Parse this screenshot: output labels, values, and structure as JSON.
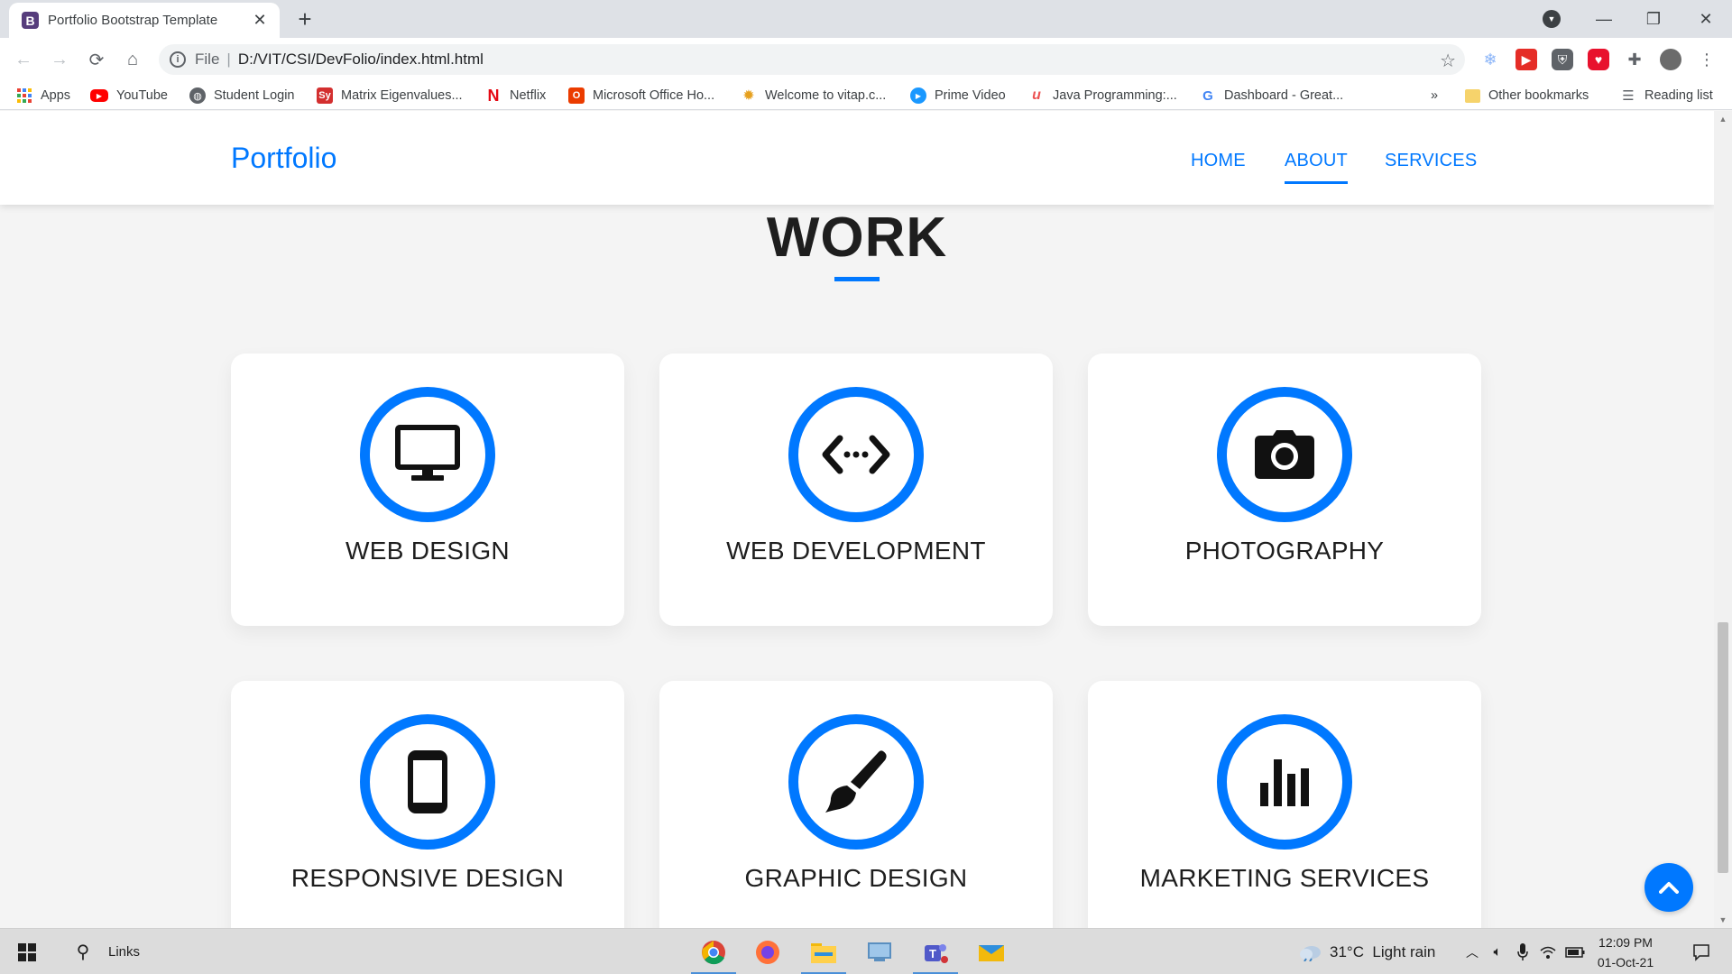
{
  "browser": {
    "tab_title": "Portfolio Bootstrap Template",
    "tab_favicon": "B",
    "address_scheme": "File",
    "address_url": "D:/VIT/CSI/DevFolio/index.html.html"
  },
  "bookmarks": {
    "items": [
      {
        "label": "Apps",
        "icon": "apps-grid-icon"
      },
      {
        "label": "YouTube",
        "icon": "youtube-icon"
      },
      {
        "label": "Student Login",
        "icon": "globe-icon"
      },
      {
        "label": "Matrix Eigenvalues...",
        "icon": "symbolab-icon"
      },
      {
        "label": "Netflix",
        "icon": "netflix-icon"
      },
      {
        "label": "Microsoft Office Ho...",
        "icon": "office-icon"
      },
      {
        "label": "Welcome to vitap.c...",
        "icon": "vitap-icon"
      },
      {
        "label": "Prime Video",
        "icon": "prime-video-icon"
      },
      {
        "label": "Java Programming:...",
        "icon": "udemy-icon"
      },
      {
        "label": "Dashboard - Great...",
        "icon": "google-icon"
      }
    ],
    "overflow": "»",
    "other_bookmarks": "Other bookmarks",
    "reading_list": "Reading list"
  },
  "page": {
    "brand": "Portfolio",
    "nav": [
      {
        "label": "HOME",
        "active": false
      },
      {
        "label": "ABOUT",
        "active": true
      },
      {
        "label": "SERVICES",
        "active": false
      }
    ],
    "section_title": "WORK",
    "services": [
      {
        "label": "WEB DESIGN",
        "icon": "monitor-icon"
      },
      {
        "label": "WEB DEVELOPMENT",
        "icon": "code-icon"
      },
      {
        "label": "PHOTOGRAPHY",
        "icon": "camera-icon"
      },
      {
        "label": "RESPONSIVE DESIGN",
        "icon": "mobile-icon"
      },
      {
        "label": "GRAPHIC DESIGN",
        "icon": "paintbrush-icon"
      },
      {
        "label": "MARKETING SERVICES",
        "icon": "bar-chart-icon"
      }
    ],
    "accent_color": "#0078ff"
  },
  "taskbar": {
    "search_label": "Links",
    "weather": "31°C  Light rain",
    "time": "12:09 PM",
    "date": "01-Oct-21"
  }
}
